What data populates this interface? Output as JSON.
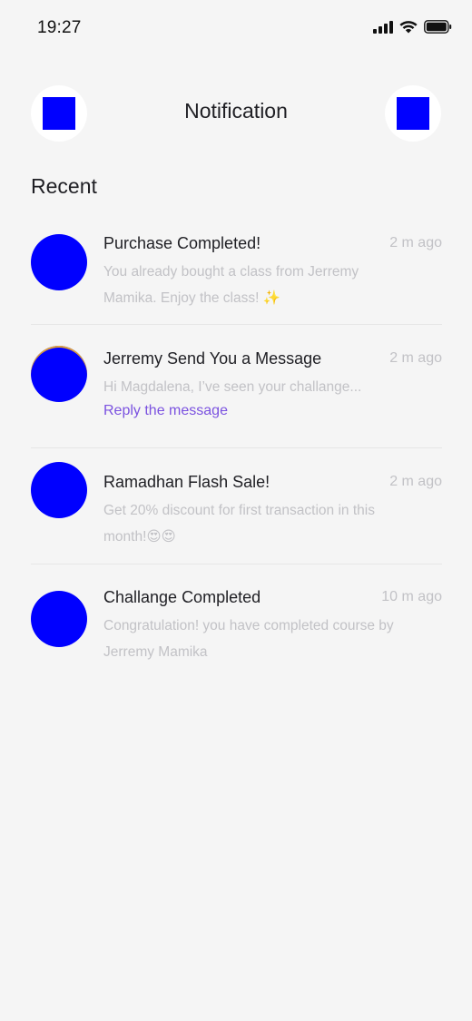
{
  "status_bar": {
    "time": "19:27",
    "icons": [
      "signal-icon",
      "wifi-icon",
      "battery-icon"
    ]
  },
  "header": {
    "title": "Notification",
    "left_button_icon": "back-icon",
    "right_button_icon": "settings-icon"
  },
  "section": {
    "title": "Recent"
  },
  "notifications": [
    {
      "title": "Purchase Completed!",
      "time": "2 m ago",
      "body": "You already bought a class from Jerremy Mamika. Enjoy the class! ✨"
    },
    {
      "title": "Jerremy Send You a Message",
      "time": "2 m ago",
      "body": "Hi Magdalena, I’ve seen your challange...",
      "link": "Reply the message"
    },
    {
      "title": "Ramadhan Flash Sale!",
      "time": "2 m ago",
      "body": "Get 20% discount for first transaction in this month!😍😍"
    },
    {
      "title": "Challange Completed",
      "time": "10 m ago",
      "body": "Congratulation! you have completed course by Jerremy Mamika"
    }
  ],
  "colors": {
    "background": "#f5f5f5",
    "placeholder": "#0000ff",
    "link": "#7b52e0",
    "muted_text": "#c2c2c6",
    "avatar_ring": "#e0a23b"
  }
}
